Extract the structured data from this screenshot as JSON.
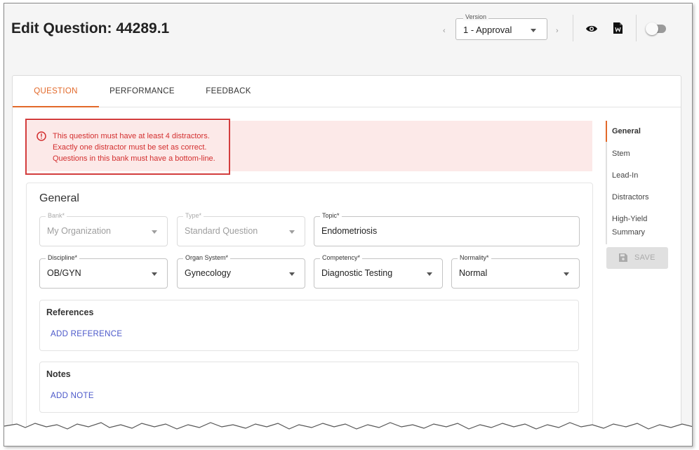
{
  "header": {
    "title": "Edit Question: 44289.1",
    "version_legend": "Version",
    "version_value": "1 - Approval"
  },
  "tabs": [
    {
      "label": "QUESTION",
      "active": true
    },
    {
      "label": "PERFORMANCE",
      "active": false
    },
    {
      "label": "FEEDBACK",
      "active": false
    }
  ],
  "alert": {
    "lines": [
      "This question must have at least 4 distractors.",
      "Exactly one distractor must be set as correct.",
      "Questions in this bank must have a bottom-line."
    ]
  },
  "general": {
    "heading": "General",
    "fields": {
      "bank": {
        "label": "Bank*",
        "value": "My Organization"
      },
      "type": {
        "label": "Type*",
        "value": "Standard Question"
      },
      "topic": {
        "label": "Topic*",
        "value": "Endometriosis"
      },
      "discipline": {
        "label": "Discipline*",
        "value": "OB/GYN"
      },
      "organ_system": {
        "label": "Organ System*",
        "value": "Gynecology"
      },
      "competency": {
        "label": "Competency*",
        "value": "Diagnostic Testing"
      },
      "normality": {
        "label": "Normality*",
        "value": "Normal"
      }
    },
    "references": {
      "title": "References",
      "link": "ADD REFERENCE"
    },
    "notes": {
      "title": "Notes",
      "link": "ADD NOTE"
    }
  },
  "right_nav": {
    "items": [
      "General",
      "Stem",
      "Lead-In",
      "Distractors",
      "High-Yield",
      "Summary"
    ],
    "save_label": "SAVE"
  },
  "colors": {
    "accent": "#e2692a",
    "error": "#d32f2f",
    "error_bg": "#fce9e8",
    "link": "#4a57c9"
  }
}
